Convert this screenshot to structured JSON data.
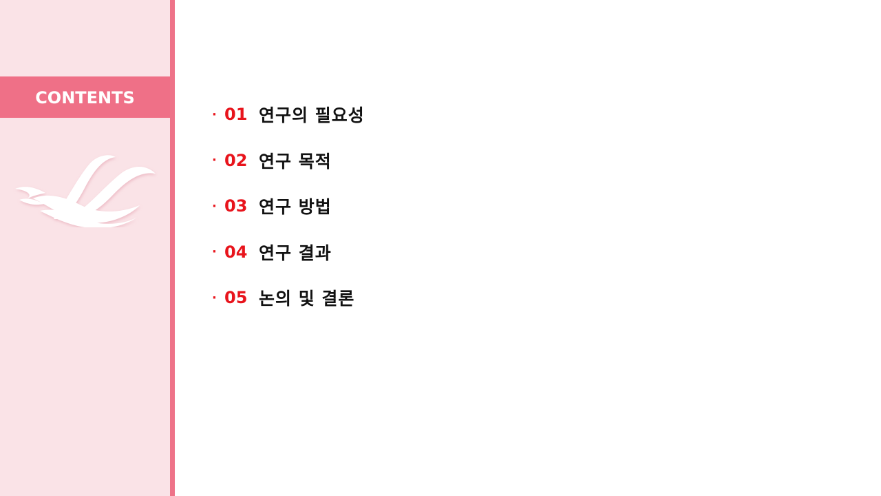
{
  "sidebar": {
    "title": "CONTENTS",
    "logo_icon": "wave-wing-logo-icon"
  },
  "toc": {
    "bullet": "·",
    "items": [
      {
        "number": "01",
        "label": "연구의 필요성"
      },
      {
        "number": "02",
        "label": "연구 목적"
      },
      {
        "number": "03",
        "label": "연구 방법"
      },
      {
        "number": "04",
        "label": "연구 결과"
      },
      {
        "number": "05",
        "label": "논의 및 결론"
      }
    ]
  },
  "colors": {
    "sidebar_bg": "#fae3e7",
    "accent_pink": "#ef7087",
    "number_red": "#e8141c",
    "label_text": "#111111"
  }
}
